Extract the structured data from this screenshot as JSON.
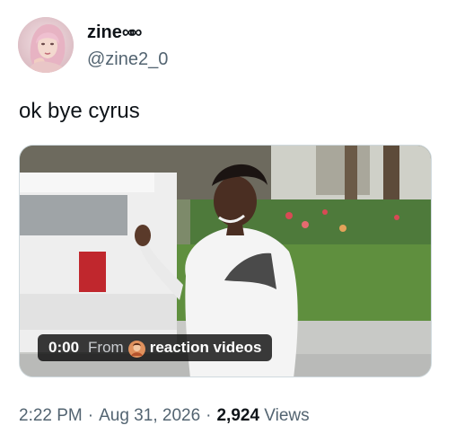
{
  "author": {
    "display_name": "zine",
    "name_glyph": "∞∞",
    "handle": "@zine2_0",
    "avatar_icon": "user-avatar-photo"
  },
  "tweet": {
    "text": "ok bye cyrus"
  },
  "media": {
    "type": "video",
    "thumbnail_icon": "video-thumbnail",
    "current_time": "0:00",
    "from_label": "From",
    "source_name": "reaction videos",
    "source_icon": "source-avatar-icon"
  },
  "meta": {
    "time": "2:22 PM",
    "separator": "·",
    "date": "Aug 31, 2026",
    "views_count": "2,924",
    "views_label": "Views"
  },
  "colors": {
    "text_primary": "#0f1419",
    "text_secondary": "#536471",
    "border": "#cfd9de",
    "pill_background": "#000000c4"
  }
}
